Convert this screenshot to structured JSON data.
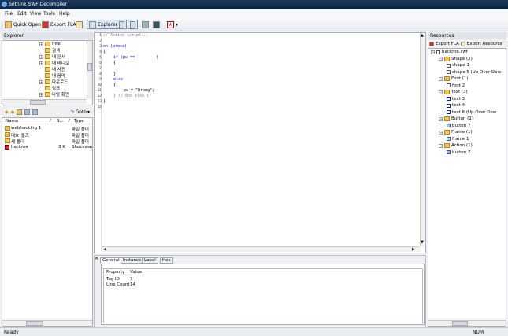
{
  "window": {
    "title": "Sothink SWF Decompiler"
  },
  "menu": [
    "File",
    "Edit",
    "View",
    "Tools",
    "Help"
  ],
  "toolbar": {
    "quick_open": "Quick Open",
    "export_fla": "Export FLA",
    "explorer": "Explorer"
  },
  "explorer": {
    "title": "Explorer",
    "tree": [
      {
        "label": "Intel",
        "pm": "+"
      },
      {
        "label": "검색",
        "pm": ""
      },
      {
        "label": "내 문서",
        "pm": "+"
      },
      {
        "label": "내 비디오",
        "pm": "+"
      },
      {
        "label": "내 사진",
        "pm": ""
      },
      {
        "label": "내 음악",
        "pm": ""
      },
      {
        "label": "다운로드",
        "pm": "+"
      },
      {
        "label": "링크",
        "pm": ""
      },
      {
        "label": "바탕 화면",
        "pm": "+"
      }
    ],
    "goto": "Goto",
    "columns": {
      "name": "Name",
      "size": "S...",
      "type": "Type"
    },
    "files": [
      {
        "name": "webhacking 1",
        "size": "",
        "type": "파일 폴더"
      },
      {
        "name": "대호_둘즈",
        "size": "",
        "type": "파일 폴더"
      },
      {
        "name": "새 폴더",
        "size": "",
        "type": "파일 폴더"
      },
      {
        "name": "hackme",
        "size": "3 K",
        "type": "Shockwave"
      }
    ]
  },
  "code": {
    "line_numbers": [
      "1",
      "2",
      "3",
      "4",
      "5",
      "6",
      "7",
      "8",
      "9",
      "10",
      "11",
      "12",
      "13",
      "14"
    ],
    "lines": [
      {
        "text": "// Action script...",
        "color": "#808080",
        "indent": 0
      },
      {
        "text": "",
        "color": "#000",
        "indent": 0
      },
      {
        "text": "on (press)",
        "color": "#0000ff",
        "indent": 0
      },
      {
        "text": "{",
        "color": "#000",
        "indent": 0
      },
      {
        "text": "if (pw ==         )",
        "color": "#0000ff",
        "indent": 1
      },
      {
        "text": "{",
        "color": "#000",
        "indent": 1
      },
      {
        "text": "",
        "color": "#000",
        "indent": 0
      },
      {
        "text": "}",
        "color": "#000",
        "indent": 1
      },
      {
        "text": "else",
        "color": "#0000ff",
        "indent": 1
      },
      {
        "text": "{",
        "color": "#000",
        "indent": 1
      },
      {
        "text": "pw = \"Wrong\";",
        "color": "#000",
        "indent": 2
      },
      {
        "text": "} // end else if",
        "color": "#808080",
        "indent": 1
      },
      {
        "text": "}",
        "color": "#000",
        "indent": 0
      },
      {
        "text": "",
        "color": "#000",
        "indent": 0
      }
    ]
  },
  "bottom": {
    "tabs": [
      "General",
      "Instance",
      "Label",
      "Hex"
    ],
    "columns": {
      "property": "Property",
      "value": "Value"
    },
    "rows": [
      {
        "property": "Tag ID",
        "value": "7"
      },
      {
        "property": "Line Count",
        "value": "14"
      }
    ]
  },
  "resources": {
    "title": "Resources",
    "export_fla": "Export FLA",
    "export_resource": "Export Resource",
    "tree": [
      {
        "label": "hackme.swf",
        "level": 0
      },
      {
        "label": "Shape (2)",
        "level": 1
      },
      {
        "label": "shape 1",
        "level": 2
      },
      {
        "label": "shape 5 (Up Over Dow",
        "level": 2
      },
      {
        "label": "Font (1)",
        "level": 1
      },
      {
        "label": "font 2",
        "level": 2
      },
      {
        "label": "Text (3)",
        "level": 1
      },
      {
        "label": "text 3",
        "level": 2
      },
      {
        "label": "text 4",
        "level": 2
      },
      {
        "label": "text 6 (Up Over Dow",
        "level": 2
      },
      {
        "label": "Button (1)",
        "level": 1
      },
      {
        "label": "button 7",
        "level": 2
      },
      {
        "label": "Frame (1)",
        "level": 1
      },
      {
        "label": "frame 1",
        "level": 2
      },
      {
        "label": "Action (1)",
        "level": 1
      },
      {
        "label": "button 7",
        "level": 2
      }
    ]
  },
  "status": {
    "left": "Ready",
    "right": "NUM"
  }
}
